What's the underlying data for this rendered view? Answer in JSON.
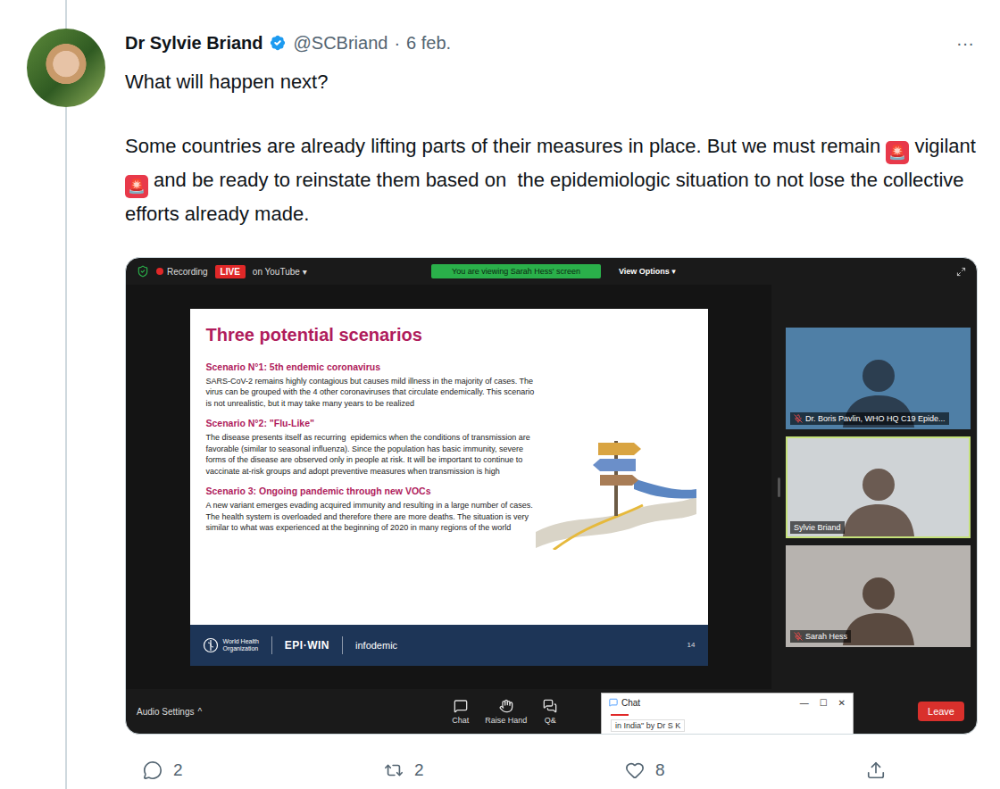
{
  "thread": {
    "author": {
      "name": "Dr Sylvie Briand",
      "verified": true,
      "handle": "@SCBriand",
      "separator": "·",
      "date": "6 feb."
    },
    "more": "···",
    "paragraphs": [
      [
        {
          "kind": "text",
          "text": "What will happen next?"
        }
      ],
      [
        {
          "kind": "text",
          "text": "Some countries are already lifting parts of their measures in place. But we must remain "
        },
        {
          "kind": "emoji",
          "text": "🚨"
        },
        {
          "kind": "text",
          "text": " vigilant "
        },
        {
          "kind": "emoji",
          "text": "🚨"
        },
        {
          "kind": "text",
          "text": " and be ready to reinstate them based on  the epidemiologic situation to not lose the collective efforts already made."
        }
      ]
    ],
    "actions": [
      {
        "kind": "reply",
        "count": "2"
      },
      {
        "kind": "retweet",
        "count": "2"
      },
      {
        "kind": "like",
        "count": "8"
      },
      {
        "kind": "share",
        "count": ""
      }
    ]
  },
  "meeting": {
    "topbar": {
      "recording": "Recording",
      "live": "LIVE",
      "stream": "on YouTube",
      "stream_caret": "▾",
      "viewing": "You are viewing Sarah Hess' screen",
      "view_options": "View Options",
      "view_caret": "▾"
    },
    "slide": {
      "title": "Three potential scenarios",
      "scenarios": [
        {
          "heading": "Scenario N°1: 5th endemic coronavirus",
          "body": "SARS-CoV-2 remains highly contagious but causes mild illness in the majority of cases. The virus can be grouped with the 4 other coronaviruses that circulate endemically. This scenario is not unrealistic, but it may take many years to be realized"
        },
        {
          "heading": "Scenario N°2: \"Flu-Like\"",
          "body": "The disease presents itself as recurring  epidemics when the conditions of transmission are favorable (similar to seasonal influenza). Since the population has basic immunity, severe forms of the disease are observed only in people at risk. It will be important to continue to vaccinate at-risk groups and adopt preventive measures when transmission is high"
        },
        {
          "heading": "Scenario 3: Ongoing pandemic through new VOCs",
          "body": "A new variant emerges evading acquired immunity and resulting in a large number of cases. The health system is overloaded and therefore there are more deaths. The situation is very similar to what was experienced at the beginning of 2020 in many regions of the world"
        }
      ],
      "footer": {
        "org": [
          "World Health",
          "Organization"
        ],
        "brands": [
          "EPI·WIN",
          "infodemic"
        ],
        "page": "14"
      }
    },
    "participants": [
      {
        "name": "Dr. Boris Pavlin, WHO HQ C19 Epide...",
        "muted": true,
        "selected": false
      },
      {
        "name": "Sylvie Briand",
        "muted": false,
        "selected": true
      },
      {
        "name": "Sarah Hess",
        "muted": true,
        "selected": false
      }
    ],
    "toolbar": {
      "audio": "Audio Settings",
      "audio_caret": "^",
      "buttons": [
        {
          "kind": "chat",
          "label": "Chat"
        },
        {
          "kind": "hand",
          "label": "Raise Hand"
        },
        {
          "kind": "qa",
          "label": "Q&"
        }
      ],
      "leave": "Leave"
    },
    "chat_window": {
      "title": "Chat",
      "controls": [
        "—",
        "☐",
        "✕"
      ],
      "message": "in India\" by Dr S K"
    }
  }
}
